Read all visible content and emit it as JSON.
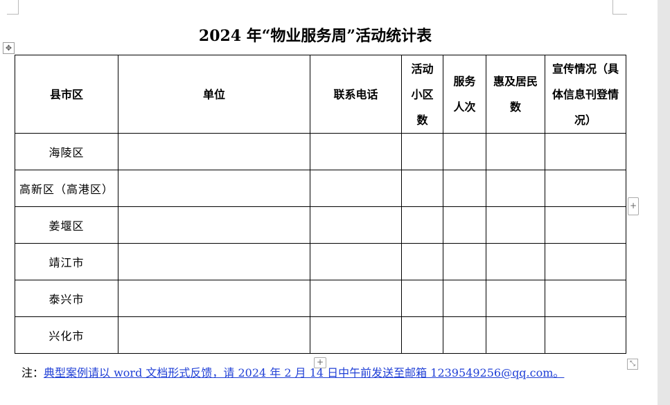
{
  "title": "2024 年“物业服务周”活动统计表",
  "table": {
    "headers": [
      "县市区",
      "单位",
      "联系电话",
      "活动小区数",
      "服务人次",
      "惠及居民数",
      "宣传情况（具体信息刊登情况）"
    ],
    "rows": [
      [
        "海陵区",
        "",
        "",
        "",
        "",
        "",
        ""
      ],
      [
        "高新区（高港区）",
        "",
        "",
        "",
        "",
        "",
        ""
      ],
      [
        "姜堰区",
        "",
        "",
        "",
        "",
        "",
        ""
      ],
      [
        "靖江市",
        "",
        "",
        "",
        "",
        "",
        ""
      ],
      [
        "泰兴市",
        "",
        "",
        "",
        "",
        "",
        ""
      ],
      [
        "兴化市",
        "",
        "",
        "",
        "",
        "",
        ""
      ]
    ]
  },
  "note": {
    "label": "注：",
    "text": "典型案例请以 word 文档形式反馈，请 2024 年 2 月 14 日中午前发送至邮箱 1239549256@qq.com。"
  },
  "handles": {
    "move": "✥",
    "add": "+",
    "resize": "⤡"
  }
}
